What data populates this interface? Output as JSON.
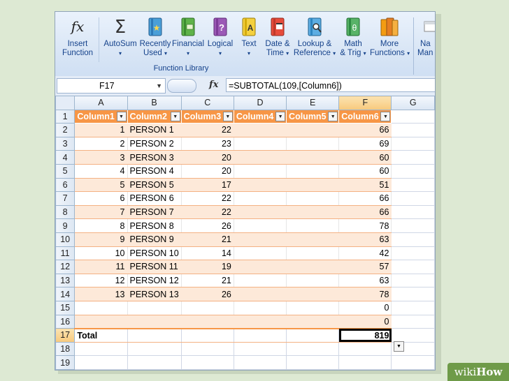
{
  "ribbon": {
    "insert_function": {
      "line1": "Insert",
      "line2": "Function",
      "icon": "fx-icon"
    },
    "buttons": [
      {
        "line1": "AutoSum",
        "line2": "",
        "icon": "sigma-icon"
      },
      {
        "line1": "Recently",
        "line2": "Used",
        "icon": "book-star-icon"
      },
      {
        "line1": "Financial",
        "line2": "",
        "icon": "book-money-icon"
      },
      {
        "line1": "Logical",
        "line2": "",
        "icon": "book-question-icon"
      },
      {
        "line1": "Text",
        "line2": "",
        "icon": "book-text-icon"
      },
      {
        "line1": "Date &",
        "line2": "Time",
        "icon": "book-calendar-icon"
      },
      {
        "line1": "Lookup &",
        "line2": "Reference",
        "icon": "book-magnifier-icon"
      },
      {
        "line1": "Math",
        "line2": "& Trig",
        "icon": "book-theta-icon"
      },
      {
        "line1": "More",
        "line2": "Functions",
        "icon": "books-icon"
      }
    ],
    "name_manager": {
      "line1": "Na",
      "line2": "Man"
    },
    "group_label": "Function Library"
  },
  "formula_bar": {
    "name_box": "F17",
    "fx_label": "fx",
    "formula": "=SUBTOTAL(109,[Column6])"
  },
  "columns": [
    "A",
    "B",
    "C",
    "D",
    "E",
    "F",
    "G"
  ],
  "table_headers": [
    "Column1",
    "Column2",
    "Column3",
    "Column4",
    "Column5",
    "Column6"
  ],
  "rows": [
    {
      "r": "2",
      "a": "1",
      "b": "PERSON 1",
      "c": "22",
      "f": "66"
    },
    {
      "r": "3",
      "a": "2",
      "b": "PERSON 2",
      "c": "23",
      "f": "69"
    },
    {
      "r": "4",
      "a": "3",
      "b": "PERSON 3",
      "c": "20",
      "f": "60"
    },
    {
      "r": "5",
      "a": "4",
      "b": "PERSON 4",
      "c": "20",
      "f": "60"
    },
    {
      "r": "6",
      "a": "5",
      "b": "PERSON 5",
      "c": "17",
      "f": "51"
    },
    {
      "r": "7",
      "a": "6",
      "b": "PERSON 6",
      "c": "22",
      "f": "66"
    },
    {
      "r": "8",
      "a": "7",
      "b": "PERSON 7",
      "c": "22",
      "f": "66"
    },
    {
      "r": "9",
      "a": "8",
      "b": "PERSON 8",
      "c": "26",
      "f": "78"
    },
    {
      "r": "10",
      "a": "9",
      "b": "PERSON 9",
      "c": "21",
      "f": "63"
    },
    {
      "r": "11",
      "a": "10",
      "b": "PERSON 10",
      "c": "14",
      "f": "42"
    },
    {
      "r": "12",
      "a": "11",
      "b": "PERSON 11",
      "c": "19",
      "f": "57"
    },
    {
      "r": "13",
      "a": "12",
      "b": "PERSON 12",
      "c": "21",
      "f": "63"
    },
    {
      "r": "14",
      "a": "13",
      "b": "PERSON 13",
      "c": "26",
      "f": "78"
    },
    {
      "r": "15",
      "a": "",
      "b": "",
      "c": "",
      "f": "0"
    },
    {
      "r": "16",
      "a": "",
      "b": "",
      "c": "",
      "f": "0"
    }
  ],
  "total_row": {
    "r": "17",
    "label": "Total",
    "value": "819"
  },
  "extra_rows": [
    "18",
    "19"
  ],
  "header_row_number": "1",
  "badge": {
    "part1": "wiki",
    "part2": "How"
  },
  "colors": {
    "table_header": "#f79646",
    "band": "#fde9d9",
    "background": "#dde9d3"
  }
}
